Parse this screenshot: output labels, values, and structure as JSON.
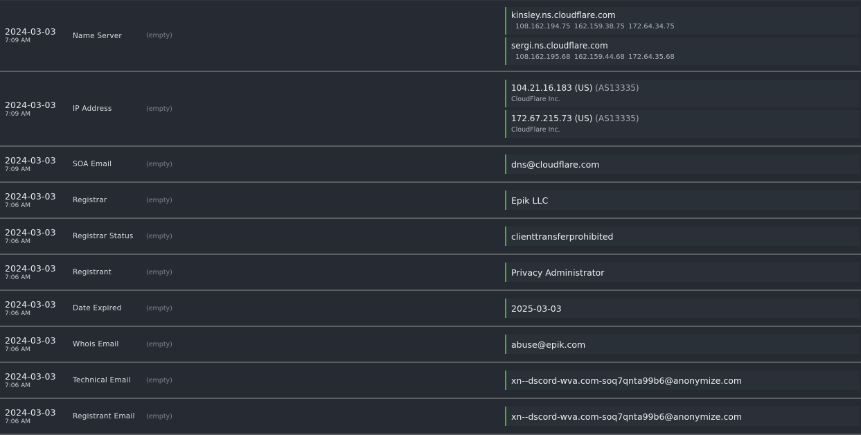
{
  "rows": [
    {
      "date": "2024-03-03",
      "time": "7:09 AM",
      "type": "Name Server",
      "old": "(empty)",
      "values": [
        {
          "main": "kinsley.ns.cloudflare.com",
          "sub": "108.162.194.75  162.159.38.75  172.64.34.75"
        },
        {
          "main": "sergi.ns.cloudflare.com",
          "sub": "108.162.195.68  162.159.44.68  172.64.35.68"
        }
      ]
    },
    {
      "date": "2024-03-03",
      "time": "7:09 AM",
      "type": "IP Address",
      "old": "(empty)",
      "values": [
        {
          "main": "104.21.16.183  (US)",
          "asn": "(AS13335)",
          "org": "CloudFlare Inc."
        },
        {
          "main": "172.67.215.73  (US)",
          "asn": "(AS13335)",
          "org": "CloudFlare Inc."
        }
      ]
    },
    {
      "date": "2024-03-03",
      "time": "7:09 AM",
      "type": "SOA Email",
      "old": "(empty)",
      "value": "dns@cloudflare.com"
    },
    {
      "date": "2024-03-03",
      "time": "7:06 AM",
      "type": "Registrar",
      "old": "(empty)",
      "value": "Epik LLC"
    },
    {
      "date": "2024-03-03",
      "time": "7:06 AM",
      "type": "Registrar Status",
      "old": "(empty)",
      "value": "clienttransferprohibited"
    },
    {
      "date": "2024-03-03",
      "time": "7:06 AM",
      "type": "Registrant",
      "old": "(empty)",
      "value": "Privacy Administrator"
    },
    {
      "date": "2024-03-03",
      "time": "7:06 AM",
      "type": "Date Expired",
      "old": "(empty)",
      "value": "2025-03-03"
    },
    {
      "date": "2024-03-03",
      "time": "7:06 AM",
      "type": "Whois Email",
      "old": "(empty)",
      "value": "abuse@epik.com"
    },
    {
      "date": "2024-03-03",
      "time": "7:06 AM",
      "type": "Technical Email",
      "old": "(empty)",
      "value": "xn--dscord-wva.com-soq7qnta99b6@anonymize.com"
    },
    {
      "date": "2024-03-03",
      "time": "7:06 AM",
      "type": "Registrant Email",
      "old": "(empty)",
      "value": "xn--dscord-wva.com-soq7qnta99b6@anonymize.com"
    }
  ],
  "colors": {
    "accent": "#4caf2e",
    "background": "#262b33",
    "divider": "#5b5f64"
  }
}
